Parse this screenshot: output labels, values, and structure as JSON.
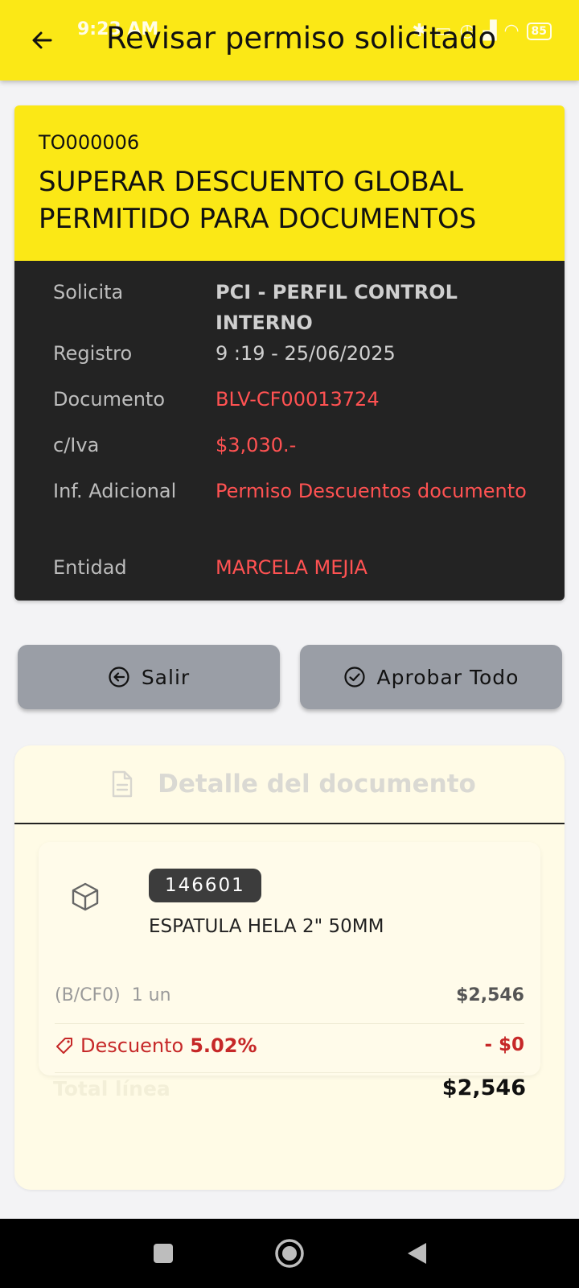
{
  "status_bar": {
    "time": "9:23 AM",
    "battery": "85"
  },
  "appbar": {
    "title": "Revisar permiso solicitado"
  },
  "permission": {
    "code": "TO000006",
    "title": "SUPERAR DESCUENTO GLOBAL PERMITIDO PARA DOCUMENTOS",
    "rows": [
      {
        "label": "Solicita",
        "value": "PCI - PERFIL CONTROL INTERNO"
      },
      {
        "label": "Registro",
        "value": "9 :19 - 25/06/2025"
      },
      {
        "label": "Documento",
        "value": "BLV-CF00013724"
      },
      {
        "label": "c/Iva",
        "value": "$3,030.-"
      },
      {
        "label": "Inf. Adicional",
        "value": "Permiso Descuentos documento"
      },
      {
        "label": "Entidad",
        "value": "MARCELA MEJIA"
      }
    ]
  },
  "actions": {
    "exit_label": "Salir",
    "approve_label": "Aprobar Todo"
  },
  "detail": {
    "title": "Detalle del documento",
    "item": {
      "sku": "146601",
      "name": "ESPATULA HELA 2\" 50MM",
      "doc_type": "(B/CF0)",
      "quantity": "1 un",
      "price": "$2,546",
      "discount_label": "Descuento",
      "discount_pct": "5.02%",
      "discount_amount": "- $0"
    },
    "total_label": "Total línea",
    "total_value": "$2,546"
  },
  "colors": {
    "accent_yellow": "#fbe816",
    "dark_panel": "#232323",
    "danger_red": "#ff5252",
    "button_gray": "#9a9ea6"
  }
}
